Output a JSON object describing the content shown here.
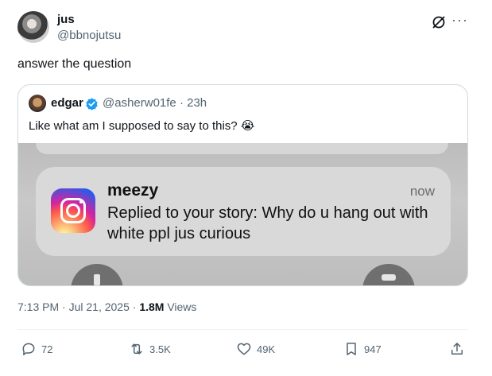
{
  "author": {
    "name": "jus",
    "handle": "@bbnojutsu"
  },
  "tweet": {
    "text": "answer the question"
  },
  "quote": {
    "name": "edgar",
    "handle_time": "@asherw01fe · 23h",
    "text": "Like what am I supposed to say to this?",
    "emoji": "😭"
  },
  "notification": {
    "title": "meezy",
    "time": "now",
    "body": "Replied to your story: Why do u hang out with white ppl jus curious"
  },
  "meta": {
    "timestamp": "7:13 PM · Jul 21, 2025 · ",
    "views_count": "1.8M",
    "views_label": " Views"
  },
  "actions": {
    "replies": "72",
    "reposts": "3.5K",
    "likes": "49K",
    "bookmarks": "947"
  },
  "header_icons": {
    "more": "···"
  },
  "colors": {
    "secondary_text": "#536471",
    "verified": "#1d9bf0"
  }
}
